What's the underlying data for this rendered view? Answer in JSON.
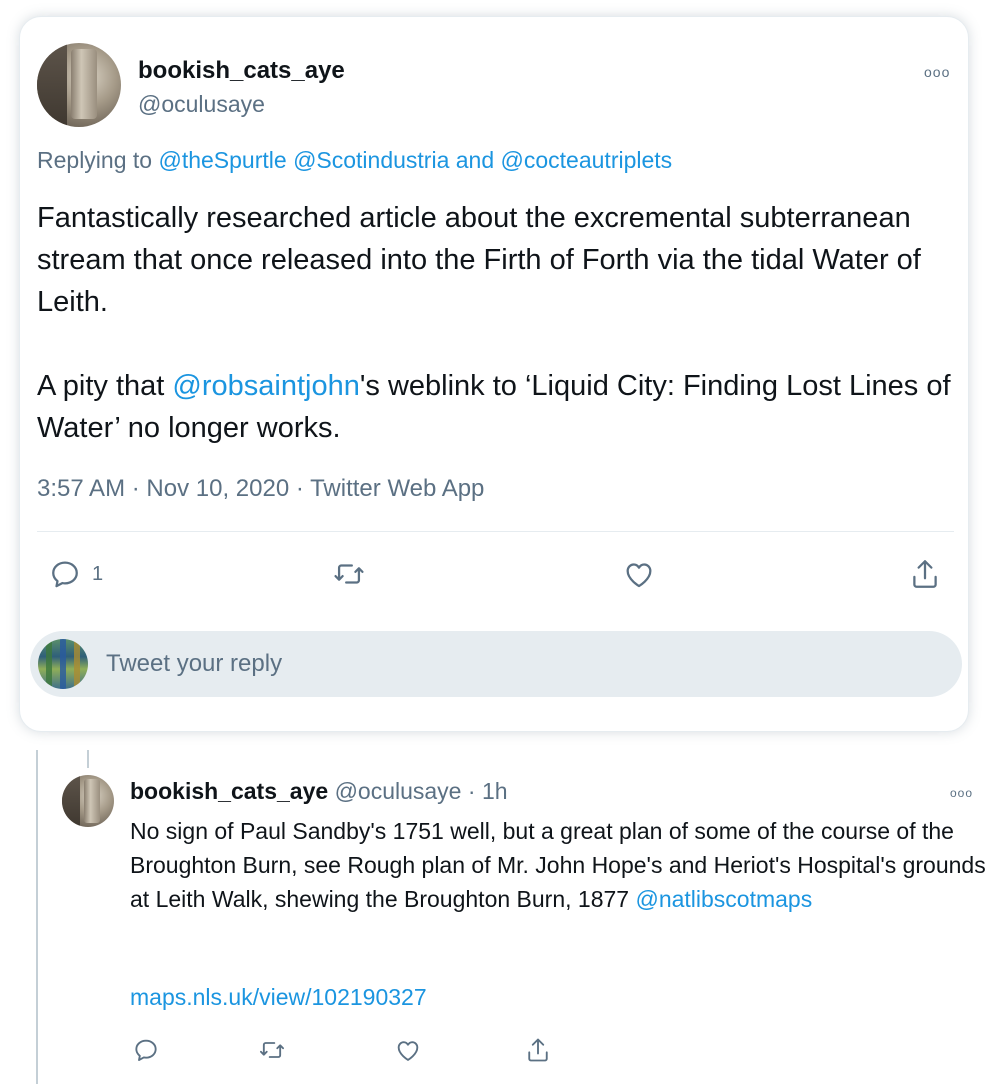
{
  "tweet": {
    "display_name": "bookish_cats_aye",
    "handle": "@oculusaye",
    "more_label": "ooo",
    "replying_prefix": "Replying to",
    "replying_to": [
      "@theSpurtle",
      "@Scotindustria"
    ],
    "replying_and": "and",
    "replying_last": "@cocteautriplets",
    "text_p1": "Fantastically researched article about the excremental subterranean stream that once released into the Firth of Forth via the tidal Water of Leith.",
    "text_p2_before": "A pity that ",
    "text_p2_mention": "@robsaintjohn",
    "text_p2_after": "'s weblink to ‘Liquid City: Finding Lost Lines of Water’ no longer works.",
    "time": "3:57 AM",
    "date": "Nov 10, 2020",
    "source": "Twitter Web App",
    "separator": "·",
    "reply_count": "1",
    "icons": [
      "reply-icon",
      "retweet-icon",
      "like-icon",
      "share-icon"
    ]
  },
  "reply_composer": {
    "placeholder": "Tweet your reply"
  },
  "reply": {
    "display_name": "bookish_cats_aye",
    "handle": "@oculusaye",
    "separator": "·",
    "time": "1h",
    "more_label": "ooo",
    "text": "No sign of Paul Sandby's 1751 well, but a great plan of some of the course of the Broughton Burn, see Rough plan of Mr. John Hope's and Heriot's Hospital's grounds at Leith Walk, shewing the Broughton Burn, 1877 ",
    "mention": "@natlibscotmaps",
    "link": "maps.nls.uk/view/102190327",
    "icons": [
      "reply-icon",
      "retweet-icon",
      "like-icon",
      "share-icon"
    ]
  },
  "colors": {
    "link": "#1b95e0",
    "secondary_text": "#5b7083",
    "primary_text": "#0f1419",
    "divider": "#e6ecf0"
  }
}
